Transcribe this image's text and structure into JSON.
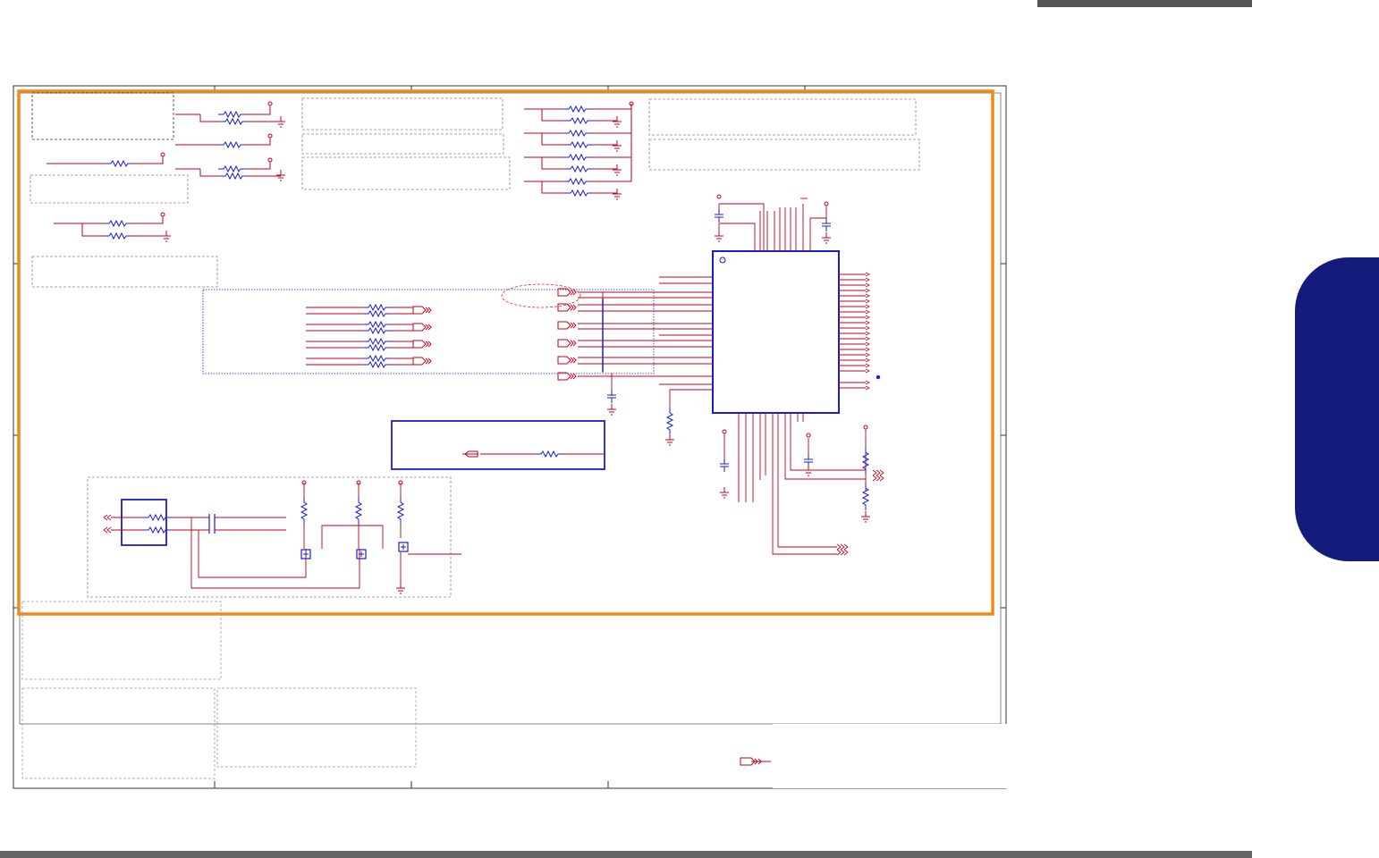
{
  "page": {
    "accent_color": "#141b7a",
    "highlight_color": "#ef8a17",
    "wire_color": "#c0001a",
    "component_color": "#1b1bd6"
  },
  "schematic": {
    "resistor_symbols": 38,
    "note_boxes": 11
  }
}
